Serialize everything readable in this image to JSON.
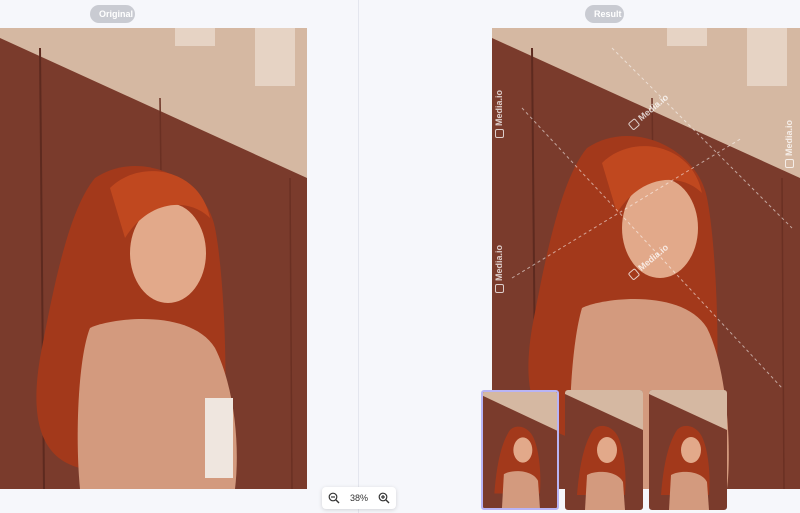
{
  "labels": {
    "original": "Original",
    "result": "Result"
  },
  "watermark": {
    "text": "Media.io"
  },
  "zoom": {
    "value": "38%",
    "zoom_out_icon": "zoom-out-icon",
    "zoom_in_icon": "zoom-in-icon"
  },
  "thumbnails": {
    "count": 3,
    "selected_index": 0
  },
  "colors": {
    "background": "#f6f7fb",
    "pill": "#c9cbd2",
    "selection_border": "#b9b4f5",
    "wall": "#7a3b2c",
    "hair": "#b8421e",
    "skin": "#e2a98a",
    "upper_wall": "#d5b8a2"
  }
}
